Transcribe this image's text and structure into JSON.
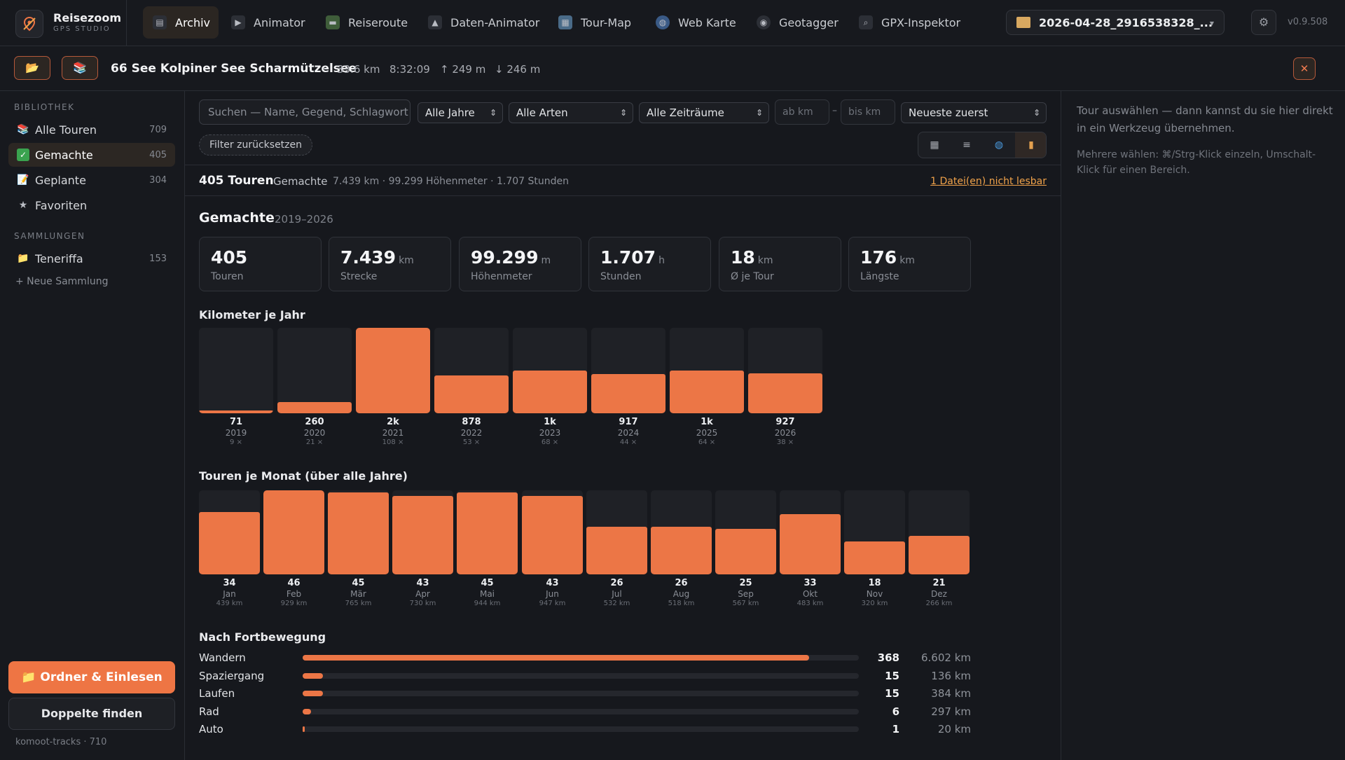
{
  "brand": {
    "name": "Reisezoom",
    "sub": "GPS STUDIO"
  },
  "nav": [
    {
      "label": "Archiv",
      "icon": "books-icon",
      "active": true
    },
    {
      "label": "Animator",
      "icon": "play-icon"
    },
    {
      "label": "Reiseroute",
      "icon": "route-icon"
    },
    {
      "label": "Daten-Animator",
      "icon": "mountain-icon"
    },
    {
      "label": "Tour-Map",
      "icon": "map-icon"
    },
    {
      "label": "Web Karte",
      "icon": "globe-icon"
    },
    {
      "label": "Geotagger",
      "icon": "camera-icon"
    },
    {
      "label": "GPX-Inspektor",
      "icon": "magnifier-icon"
    }
  ],
  "file": {
    "label": "2026-04-28_2916538328_..."
  },
  "version": "v0.9.508",
  "tour": {
    "title": "66 See Kolpiner See Scharmützelsee",
    "distance": "33.6 km",
    "duration": "8:32:09",
    "ascent": "↑ 249 m",
    "descent": "↓ 246 m"
  },
  "sidebar": {
    "library_heading": "BIBLIOTHEK",
    "items": [
      {
        "label": "Alle Touren",
        "count": "709",
        "icon": "books-icon"
      },
      {
        "label": "Gemachte",
        "count": "405",
        "icon": "check-icon",
        "active": true
      },
      {
        "label": "Geplante",
        "count": "304",
        "icon": "memo-icon"
      },
      {
        "label": "Favoriten",
        "count": "",
        "icon": "star-icon"
      }
    ],
    "collections_heading": "SAMMLUNGEN",
    "collections": [
      {
        "label": "Teneriffa",
        "count": "153",
        "icon": "folder-icon"
      }
    ],
    "new_collection": "+ Neue Sammlung",
    "primary_button": "📁 Ordner & Einlesen",
    "secondary_button": "Doppelte finden",
    "footer": "komoot-tracks · 710"
  },
  "filters": {
    "search_placeholder": "Suchen — Name, Gegend, Schlagwort",
    "years": "Alle Jahre",
    "types": "Alle Arten",
    "periods": "Alle Zeiträume",
    "from_km": "ab km",
    "to_km": "bis km",
    "sort": "Neueste zuerst",
    "reset": "Filter zurücksetzen"
  },
  "summary": {
    "count": "405 Touren",
    "label": "Gemachte",
    "stats": "7.439 km · 99.299 Höhenmeter · 1.707 Stunden",
    "warning": "1 Datei(en) nicht lesbar"
  },
  "section": {
    "title": "Gemachte",
    "range": "2019–2026"
  },
  "stats": [
    {
      "value": "405",
      "unit": "",
      "label": "Touren"
    },
    {
      "value": "7.439",
      "unit": "km",
      "label": "Strecke"
    },
    {
      "value": "99.299",
      "unit": "m",
      "label": "Höhenmeter"
    },
    {
      "value": "1.707",
      "unit": "h",
      "label": "Stunden"
    },
    {
      "value": "18",
      "unit": "km",
      "label": "Ø je Tour"
    },
    {
      "value": "176",
      "unit": "km",
      "label": "Längste"
    }
  ],
  "chart_data": [
    {
      "type": "bar",
      "title": "Kilometer je Jahr",
      "categories": [
        "2019",
        "2020",
        "2021",
        "2022",
        "2023",
        "2024",
        "2025",
        "2026"
      ],
      "values": [
        71,
        260,
        2000,
        878,
        1000,
        917,
        1000,
        927
      ],
      "value_labels": [
        "71",
        "260",
        "2k",
        "878",
        "1k",
        "917",
        "1k",
        "927"
      ],
      "counts": [
        "9 ×",
        "21 ×",
        "108 ×",
        "53 ×",
        "68 ×",
        "44 ×",
        "64 ×",
        "38 ×"
      ]
    },
    {
      "type": "bar",
      "title": "Touren je Monat (über alle Jahre)",
      "categories": [
        "Jan",
        "Feb",
        "Mär",
        "Apr",
        "Mai",
        "Jun",
        "Jul",
        "Aug",
        "Sep",
        "Okt",
        "Nov",
        "Dez"
      ],
      "values": [
        34,
        46,
        45,
        43,
        45,
        43,
        26,
        26,
        25,
        33,
        18,
        21
      ],
      "km": [
        "439 km",
        "929 km",
        "765 km",
        "730 km",
        "944 km",
        "947 km",
        "532 km",
        "518 km",
        "567 km",
        "483 km",
        "320 km",
        "266 km"
      ]
    },
    {
      "type": "bar",
      "title": "Nach Fortbewegung",
      "categories": [
        "Wandern",
        "Spaziergang",
        "Laufen",
        "Rad",
        "Auto"
      ],
      "values": [
        368,
        15,
        15,
        6,
        1
      ],
      "km": [
        "6.602 km",
        "136 km",
        "384 km",
        "297 km",
        "20 km"
      ]
    }
  ],
  "right_panel": {
    "hint": "Tour auswählen — dann kannst du sie hier direkt in ein Werkzeug übernehmen.",
    "multi": "Mehrere wählen: ⌘/Strg-Klick einzeln, Umschalt-Klick für einen Bereich."
  },
  "colors": {
    "accent": "#ec7646",
    "background": "#16181d",
    "panel": "#17191e"
  }
}
